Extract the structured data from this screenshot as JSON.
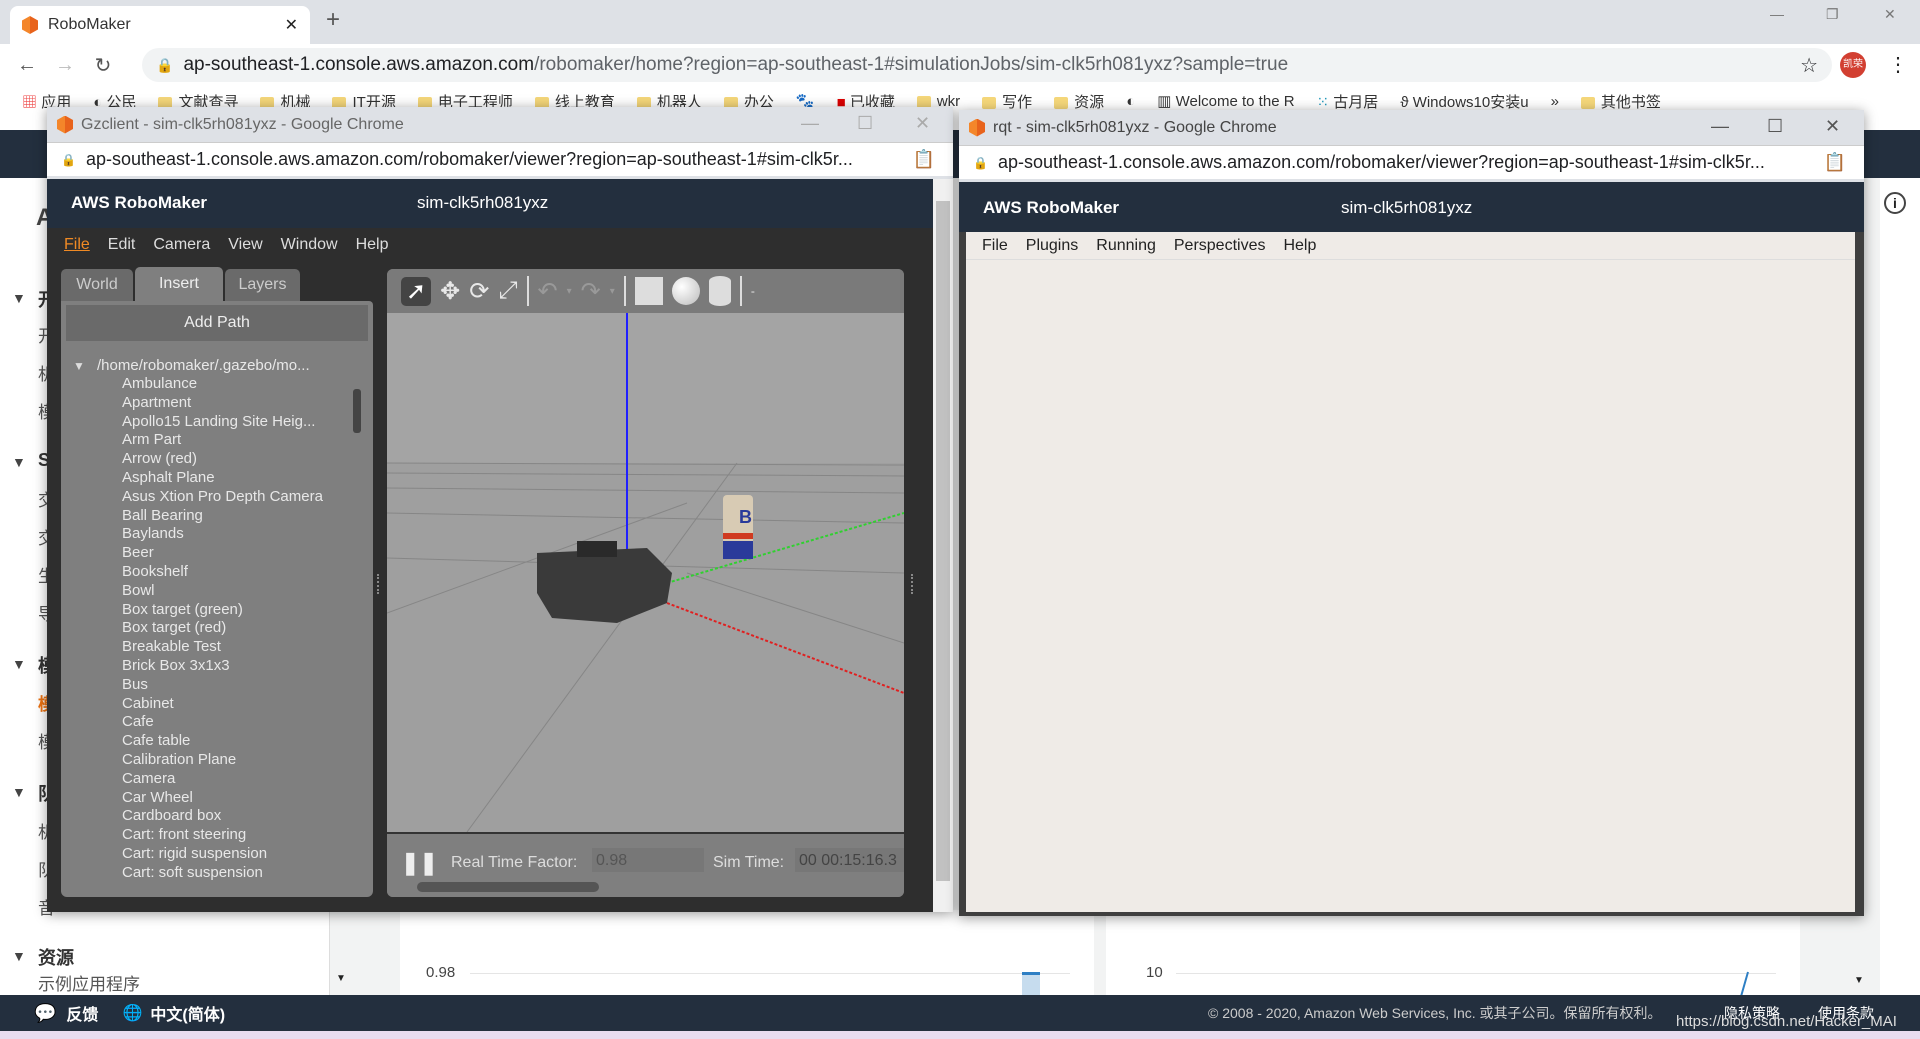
{
  "browser": {
    "tab_title": "RoboMaker",
    "url_host": "ap-southeast-1.console.aws.amazon.com",
    "url_path": "/robomaker/home?region=ap-southeast-1#simulationJobs/sim-clk5rh081yxz?sample=true",
    "profile": "凯荣"
  },
  "bookmarks": [
    "应用",
    "公民",
    "文献查寻",
    "机械",
    "IT开源",
    "电子工程师",
    "线上教育",
    "机器人",
    "办公",
    "百度",
    "已收藏",
    "wkr",
    "写作",
    "资源",
    "",
    "Welcome to the R",
    "古月居",
    "Windows10安装u",
    "»",
    "其他书签"
  ],
  "sidebar": {
    "sections": [
      "开",
      "S",
      "模",
      "队",
      "资源"
    ],
    "items": [
      "开",
      "机",
      "模",
      "交",
      "交",
      "生",
      "导",
      "模",
      "模",
      "机",
      "队",
      "音",
      "示例应用程序"
    ],
    "page_initial": "A"
  },
  "charts": {
    "left_tick": "0.98",
    "right_tick": "10",
    "accent": "#2e7fc4"
  },
  "footer": {
    "feedback": "反馈",
    "language": "中文(简体)",
    "copyright": "© 2008 - 2020, Amazon Web Services, Inc. 或其子公司。保留所有权利。",
    "privacy": "隐私策略",
    "terms": "使用条款",
    "watermark": "https://blog.csdn.net/Hacker_MAI"
  },
  "gz": {
    "window_title": "Gzclient - sim-clk5rh081yxz - Google Chrome",
    "url": "ap-southeast-1.console.aws.amazon.com/robomaker/viewer?region=ap-southeast-1#sim-clk5r...",
    "brand": "AWS RoboMaker",
    "sim_id": "sim-clk5rh081yxz",
    "menu": [
      "File",
      "Edit",
      "Camera",
      "View",
      "Window",
      "Help"
    ],
    "tabs": [
      "World",
      "Insert",
      "Layers"
    ],
    "add_path": "Add Path",
    "tree_root": "/home/robomaker/.gazebo/mo...",
    "models": [
      "Ambulance",
      "Apartment",
      "Apollo15 Landing Site Heig...",
      "Arm Part",
      "Arrow (red)",
      "Asphalt Plane",
      "Asus Xtion Pro Depth Camera",
      "Ball Bearing",
      "Baylands",
      "Beer",
      "Bookshelf",
      "Bowl",
      "Box target (green)",
      "Box target (red)",
      "Breakable Test",
      "Brick Box 3x1x3",
      "Bus",
      "Cabinet",
      "Cafe",
      "Cafe table",
      "Calibration Plane",
      "Camera",
      "Car Wheel",
      "Cardboard box",
      "Cart: front steering",
      "Cart: rigid suspension",
      "Cart: soft suspension"
    ],
    "rtf_label": "Real Time Factor:",
    "rtf_value": "0.98",
    "sim_time_label": "Sim Time:",
    "sim_time_value": "00 00:15:16.3",
    "toolbar_icons": [
      "select-arrow-icon",
      "translate-icon",
      "rotate-icon",
      "scale-icon",
      "undo-icon",
      "redo-icon",
      "box-shape-icon",
      "sphere-shape-icon",
      "cylinder-shape-icon"
    ]
  },
  "rqt": {
    "window_title": "rqt - sim-clk5rh081yxz - Google Chrome",
    "url": "ap-southeast-1.console.aws.amazon.com/robomaker/viewer?region=ap-southeast-1#sim-clk5r...",
    "brand": "AWS RoboMaker",
    "sim_id": "sim-clk5rh081yxz",
    "menu": [
      "File",
      "Plugins",
      "Running",
      "Perspectives",
      "Help"
    ]
  }
}
